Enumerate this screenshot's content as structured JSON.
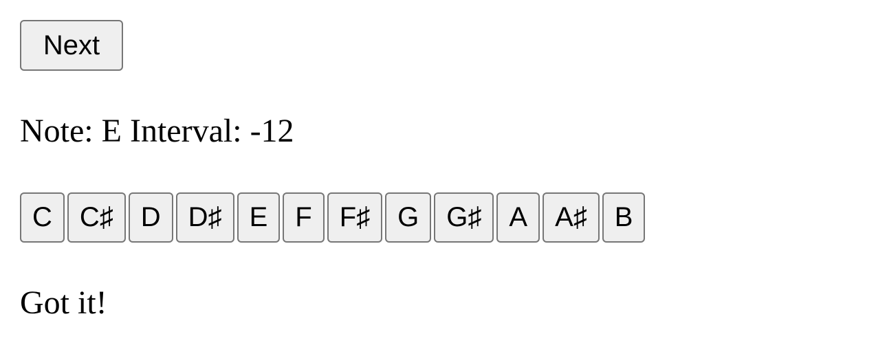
{
  "controls": {
    "next_label": "Next"
  },
  "prompt": {
    "note_label": "Note:",
    "note_value": "E",
    "interval_label": "Interval:",
    "interval_value": "-12"
  },
  "notes": [
    {
      "label": "C"
    },
    {
      "label": "C♯"
    },
    {
      "label": "D"
    },
    {
      "label": "D♯"
    },
    {
      "label": "E"
    },
    {
      "label": "F"
    },
    {
      "label": "F♯"
    },
    {
      "label": "G"
    },
    {
      "label": "G♯"
    },
    {
      "label": "A"
    },
    {
      "label": "A♯"
    },
    {
      "label": "B"
    }
  ],
  "status": {
    "message": "Got it!"
  }
}
